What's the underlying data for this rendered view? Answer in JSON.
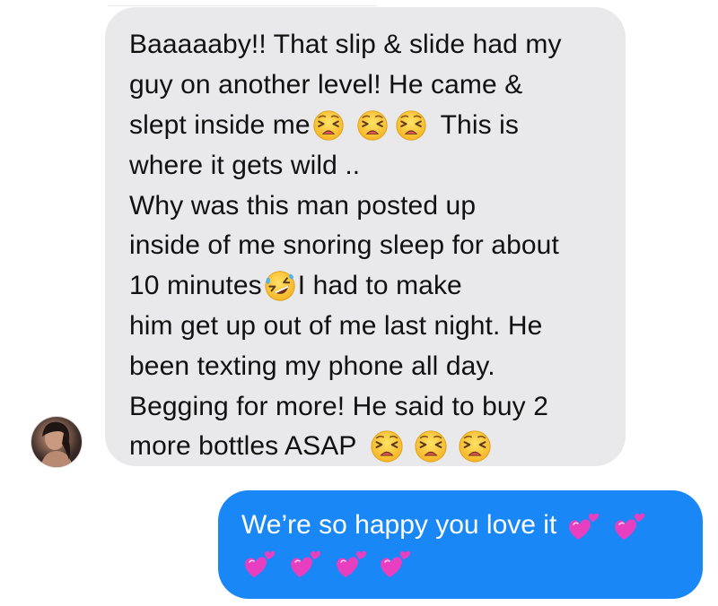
{
  "colors": {
    "incoming_bubble": "#e9e9eb",
    "outgoing_bubble": "#1a87f6",
    "incoming_text": "#111111",
    "outgoing_text": "#ffffff"
  },
  "incoming_message": {
    "lines": [
      "Baaaaaby!! That slip & slide had my",
      "guy on another level! He came &",
      "slept inside me",
      "This is",
      "where it gets wild ..",
      "Why was this man posted up",
      "inside of me snoring sleep for about",
      "10 minutes",
      "I had to make",
      "him get up out of me last night. He",
      "been texting my phone all day.",
      "Begging for more! He said to buy 2",
      "more bottles ASAP"
    ],
    "emojis": [
      "weary-face-emoji",
      "rolling-on-floor-laughing-emoji"
    ]
  },
  "sender": {
    "avatar_icon": "profile-photo-avatar"
  },
  "outgoing_message": {
    "text": "We’re so happy you love it",
    "emojis": [
      "two-hearts-emoji"
    ]
  }
}
